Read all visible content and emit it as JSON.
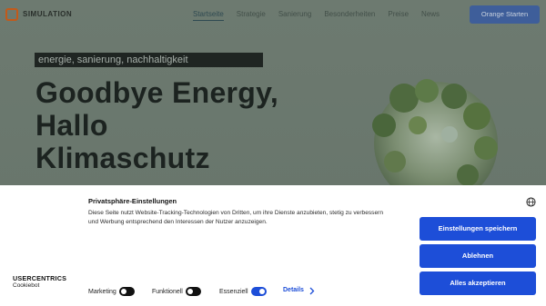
{
  "nav": {
    "brand": "SIMULATION",
    "items": [
      {
        "label": "Startseite"
      },
      {
        "label": "Strategie"
      },
      {
        "label": "Sanierung"
      },
      {
        "label": "Besonderheiten"
      },
      {
        "label": "Preise"
      },
      {
        "label": "News"
      }
    ],
    "cta_label": "Orange Starten",
    "accent_color": "#3e5e9a"
  },
  "hero": {
    "tagline": "energie, sanierung, nachhaltigkeit",
    "headline_lines": [
      "Goodbye Energy,",
      "Hallo",
      "Klimaschutz"
    ]
  },
  "cookie_banner": {
    "title": "Privatsphäre-Einstellungen",
    "text": "Diese Seite nutzt Website-Tracking-Technologien von Dritten, um ihre Dienste anzubieten, stetig zu verbessern und Werbung entsprechend den Interessen der Nutzer anzuzeigen.",
    "buttons": {
      "save": "Einstellungen speichern",
      "decline": "Ablehnen",
      "accept_all": "Alles akzeptieren"
    },
    "branding": {
      "logo_text": "USERCENTRICS",
      "sub_text": "Cookiebot"
    },
    "toggles": [
      {
        "label": "Marketing",
        "state": "off"
      },
      {
        "label": "Funktionell",
        "state": "off"
      },
      {
        "label": "Essenziell",
        "state": "on"
      }
    ],
    "details_label": "Details",
    "button_color": "#1d4ed8"
  }
}
